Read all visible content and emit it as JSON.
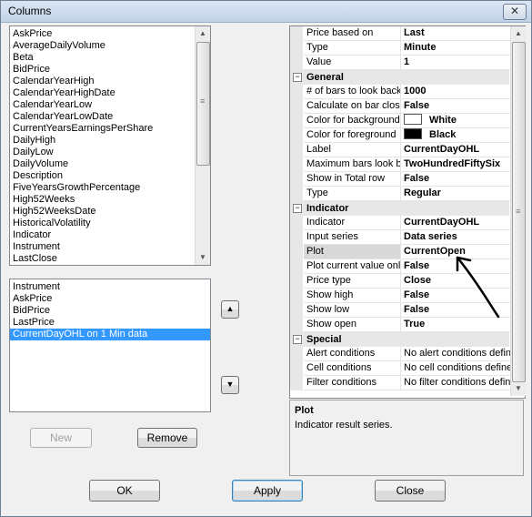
{
  "window": {
    "title": "Columns",
    "close_glyph": "✕"
  },
  "available_fields": [
    "AskPrice",
    "AverageDailyVolume",
    "Beta",
    "BidPrice",
    "CalendarYearHigh",
    "CalendarYearHighDate",
    "CalendarYearLow",
    "CalendarYearLowDate",
    "CurrentYearsEarningsPerShare",
    "DailyHigh",
    "DailyLow",
    "DailyVolume",
    "Description",
    "FiveYearsGrowthPercentage",
    "High52Weeks",
    "High52WeeksDate",
    "HistoricalVolatility",
    "Indicator",
    "Instrument",
    "LastClose"
  ],
  "selected_columns": [
    "Instrument",
    "AskPrice",
    "BidPrice",
    "LastPrice",
    "CurrentDayOHL on 1 Min data"
  ],
  "selected_column_index": 4,
  "move_up_glyph": "▲",
  "move_down_glyph": "▼",
  "buttons": {
    "new": "New",
    "remove": "Remove",
    "ok": "OK",
    "apply": "Apply",
    "close": "Close"
  },
  "properties": {
    "top_rows": [
      {
        "name": "Price based on",
        "value": "Last"
      },
      {
        "name": "Type",
        "value": "Minute"
      },
      {
        "name": "Value",
        "value": "1"
      }
    ],
    "general": {
      "label": "General",
      "rows": [
        {
          "name": "# of bars to look back",
          "value": "1000"
        },
        {
          "name": "Calculate on bar close",
          "value": "False"
        },
        {
          "name": "Color for background",
          "value": "White",
          "swatch": "#ffffff"
        },
        {
          "name": "Color for foreground",
          "value": "Black",
          "swatch": "#000000"
        },
        {
          "name": "Label",
          "value": "CurrentDayOHL"
        },
        {
          "name": "Maximum bars look back",
          "value": "TwoHundredFiftySix"
        },
        {
          "name": "Show in Total row",
          "value": "False"
        },
        {
          "name": "Type",
          "value": "Regular"
        }
      ]
    },
    "indicator": {
      "label": "Indicator",
      "rows": [
        {
          "name": "Indicator",
          "value": "CurrentDayOHL"
        },
        {
          "name": "Input series",
          "value": "Data series"
        },
        {
          "name": "Plot",
          "value": "CurrentOpen"
        },
        {
          "name": "Plot current value only",
          "value": "False"
        },
        {
          "name": "Price type",
          "value": "Close"
        },
        {
          "name": "Show high",
          "value": "False"
        },
        {
          "name": "Show low",
          "value": "False"
        },
        {
          "name": "Show open",
          "value": "True"
        }
      ]
    },
    "special": {
      "label": "Special",
      "rows": [
        {
          "name": "Alert conditions",
          "value": "No alert conditions defined"
        },
        {
          "name": "Cell conditions",
          "value": "No cell conditions defined"
        },
        {
          "name": "Filter conditions",
          "value": "No filter conditions defined"
        }
      ]
    },
    "collapse_glyph": "−"
  },
  "description": {
    "title": "Plot",
    "text": "Indicator result series."
  },
  "colors": {
    "selection": "#3399ff",
    "category_bg": "#e7e7e7"
  }
}
